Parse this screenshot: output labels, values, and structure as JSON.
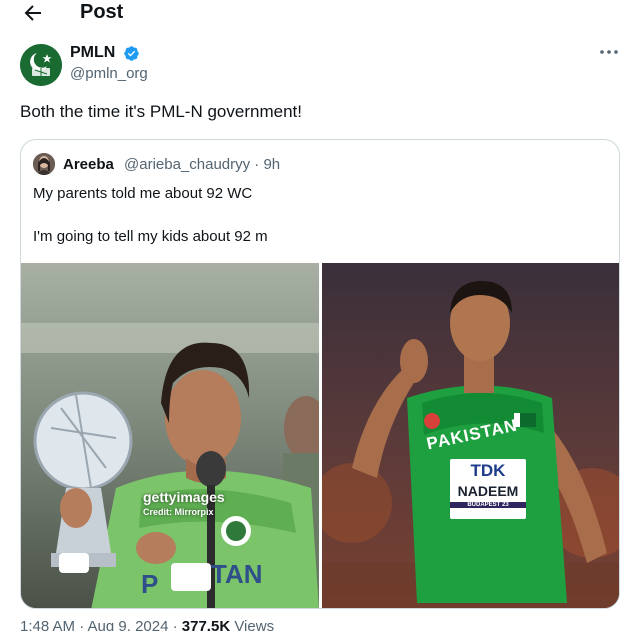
{
  "header": {
    "title": "Post",
    "back_icon": "arrow-left-icon"
  },
  "post": {
    "author_name": "PMLN",
    "author_handle": "@pmln_org",
    "verified": true,
    "text": "Both the time it's PML-N government!",
    "more_icon": "more-horizontal-icon"
  },
  "quote": {
    "author_name": "Areeba",
    "author_handle": "@arieba_chaudryy · 9h",
    "line1": "My parents told me about 92 WC",
    "line2": "I'm going to tell my kids about 92 m"
  },
  "images": {
    "left": {
      "watermark": "gettyimages",
      "credit": "Credit: Mirrorpix"
    },
    "right": {
      "jersey_text": "PAKISTAN",
      "bib_sponsor": "TDK",
      "bib_name": "NADEEM",
      "bib_event": "BUDAPEST 23"
    }
  },
  "meta": {
    "time": "1:48 AM · Aug 9, 2024 · ",
    "views_count": "377.5K",
    "views_label": " Views"
  },
  "colors": {
    "text": "#0f1419",
    "secondary": "#536471",
    "verified_blue": "#1d9bf0",
    "border": "#cfd9de",
    "brand_green": "#1a6b32"
  }
}
